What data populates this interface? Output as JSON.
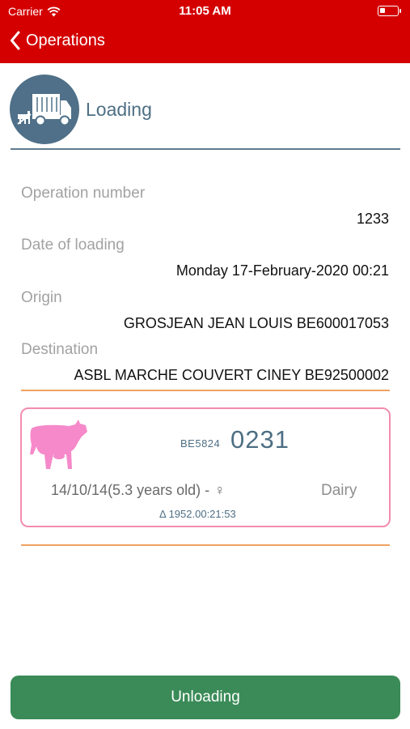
{
  "status": {
    "carrier": "Carrier",
    "time": "11:05 AM"
  },
  "nav": {
    "back_label": "Operations"
  },
  "header": {
    "title": "Loading"
  },
  "fields": {
    "operation_number": {
      "label": "Operation number",
      "value": "1233"
    },
    "date_of_loading": {
      "label": "Date of loading",
      "value": "Monday 17-February-2020 00:21"
    },
    "origin": {
      "label": "Origin",
      "value": "GROSJEAN JEAN LOUIS BE600017053"
    },
    "destination": {
      "label": "Destination",
      "value": "ASBL MARCHE COUVERT CINEY BE92500002"
    }
  },
  "animal": {
    "prefix": "BE5824",
    "number": "0231",
    "birth": "14/10/14(5.3 years old) -",
    "sex_symbol": "♀",
    "breed": "Dairy",
    "delta": "Δ 1952.00:21:53"
  },
  "actions": {
    "unloading_label": "Unloading"
  },
  "colors": {
    "nav": "#d40000",
    "accent": "#4e6f84",
    "button": "#3a8b57",
    "card_border": "#f28cb0",
    "cow": "#f589c9",
    "divider": "#f0a262"
  }
}
